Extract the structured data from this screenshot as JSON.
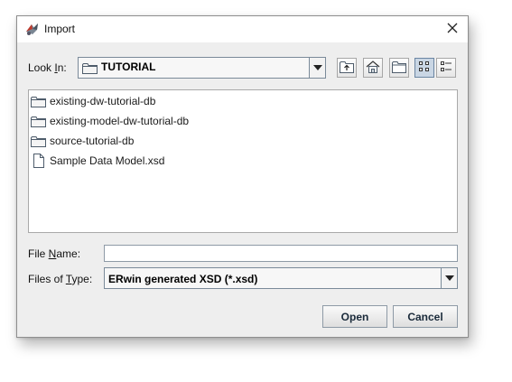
{
  "window": {
    "title": "Import",
    "icon": "app-logo-icon",
    "close_icon": "close-icon"
  },
  "look_in": {
    "label_before": "Look ",
    "label_mnemonic": "I",
    "label_after": "n:",
    "value": "TUTORIAL",
    "value_icon": "folder-icon"
  },
  "toolbar": {
    "buttons": [
      {
        "name": "up-one-level-button",
        "icon": "folder-up-icon"
      },
      {
        "name": "home-button",
        "icon": "home-icon"
      },
      {
        "name": "new-folder-button",
        "icon": "new-folder-icon"
      },
      {
        "name": "list-view-button",
        "icon": "list-view-icon",
        "pressed": true
      },
      {
        "name": "details-view-button",
        "icon": "details-view-icon"
      }
    ]
  },
  "files": [
    {
      "name": "existing-dw-tutorial-db",
      "type": "folder"
    },
    {
      "name": "existing-model-dw-tutorial-db",
      "type": "folder"
    },
    {
      "name": "source-tutorial-db",
      "type": "folder"
    },
    {
      "name": "Sample Data Model.xsd",
      "type": "file"
    }
  ],
  "file_name": {
    "label_before": "File ",
    "label_mnemonic": "N",
    "label_after": "ame:",
    "value": ""
  },
  "file_type": {
    "label_before": "Files of ",
    "label_mnemonic": "T",
    "label_after": "ype:",
    "value": "ERwin generated XSD (*.xsd)"
  },
  "buttons": {
    "open": "Open",
    "cancel": "Cancel"
  }
}
